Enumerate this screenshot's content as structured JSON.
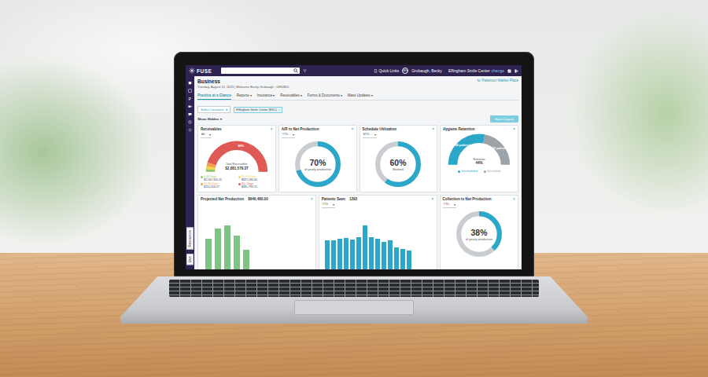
{
  "topbar": {
    "logo": "FUSE",
    "quick_links": "Quick Links",
    "avatar": "BG",
    "user": "Grubaugh, Becky",
    "office": "Effingham Smile Center",
    "change": "change"
  },
  "side_tabs": [
    {
      "label": "Resources"
    },
    {
      "label": "Live"
    }
  ],
  "header": {
    "title": "Business",
    "subtitle": "Tuesday, August 15, 2023 | Welcome Becky Grubaugh - GRUB01",
    "market": "Patterson Market Place"
  },
  "caret": "▾",
  "close": "×",
  "tabs": [
    {
      "label": "Practice at a Glance",
      "selected": true,
      "dropdown": false
    },
    {
      "label": "Reports",
      "selected": false,
      "dropdown": true
    },
    {
      "label": "Insurance",
      "selected": false,
      "dropdown": true
    },
    {
      "label": "Receivables",
      "selected": false,
      "dropdown": true
    },
    {
      "label": "Forms & Documents",
      "selected": false,
      "dropdown": true
    },
    {
      "label": "Mass Updates",
      "selected": false,
      "dropdown": true
    }
  ],
  "filters": {
    "select": "Select Locations",
    "chip": "Effingham Smile Center (ESC)"
  },
  "show_hidden": "Show Hidden",
  "save_button": "Save Layout",
  "cards_top": [
    {
      "kind": "receivables",
      "title": "Receivables",
      "period": "All",
      "center_label": "Total Receivables",
      "center_value": "$2,881,579.37",
      "segments": [
        {
          "share": 0.03,
          "color": "#8cc56b"
        },
        {
          "share": 0.03,
          "color": "#f3d34a"
        },
        {
          "share": 0.04,
          "color": "#f0a04b"
        },
        {
          "share": 0.9,
          "color": "#e05a55",
          "label": "88%"
        }
      ],
      "legend": [
        {
          "label": "0-30 Days",
          "value": "$2,162,345.55",
          "color": "#8cc56b"
        },
        {
          "label": "31-60 Days",
          "value": "$327,180.40",
          "color": "#f3d34a"
        },
        {
          "label": "61-90 Days",
          "value": "$110,254.27",
          "color": "#f0a04b"
        },
        {
          "label": "90+ Days",
          "value": "$281,799.15",
          "color": "#e05a55"
        }
      ]
    },
    {
      "kind": "donut",
      "title": "A/R to Net Production",
      "period": "YTD",
      "level": 0.7,
      "value": "70%",
      "caption": "of yearly production"
    },
    {
      "kind": "donut",
      "title": "Schedule Utilization",
      "period": "MTD",
      "level": 0.6,
      "value": "60%",
      "caption": "Booked"
    },
    {
      "kind": "retention",
      "title": "Hygiene Retention",
      "center_label": "Retention",
      "center_value": "44%",
      "segments": [
        {
          "share": 0.56,
          "color": "#2aa7c9",
          "label": "746 patients"
        },
        {
          "share": 0.44,
          "color": "#9ea3a8",
          "label": "503 patients"
        }
      ],
      "legend": [
        {
          "label": "Unscheduled",
          "color": "#2aa7c9"
        },
        {
          "label": "Scheduled",
          "color": "#9ea3a8"
        }
      ]
    }
  ],
  "cards_bottom": [
    {
      "kind": "bars",
      "title": "Projected Net Production",
      "figure": "$646,480.00",
      "color": "#7dc383",
      "values": [
        52000,
        69000,
        74000,
        57000,
        34000
      ]
    },
    {
      "kind": "bars",
      "title": "Patients Seen",
      "figure": "1293",
      "period": "YTD",
      "color": "#2aa7c9",
      "values": [
        95,
        95,
        98,
        101,
        96,
        104,
        140,
        104,
        98,
        90,
        94,
        72,
        68,
        62
      ]
    },
    {
      "kind": "donut",
      "title": "Collection to Net Production",
      "period": "YTD",
      "level": 0.38,
      "value": "38%",
      "caption": "of yearly production"
    }
  ]
}
